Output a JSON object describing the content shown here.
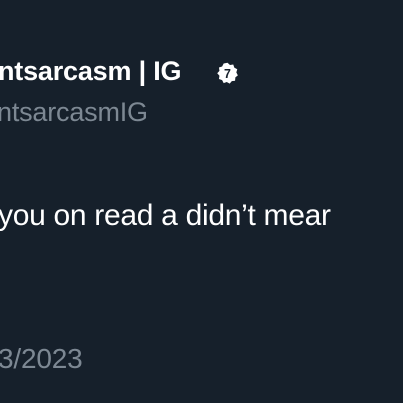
{
  "tweet": {
    "display_name": "ntsarcasm | IG",
    "badge_number": "7",
    "handle": "ntsarcasmIG",
    "text": "you on read a didn’t mear",
    "timestamp": "3/2023"
  },
  "colors": {
    "background": "#16202b",
    "primary_text": "#ffffff",
    "secondary_text": "#7d8893"
  }
}
